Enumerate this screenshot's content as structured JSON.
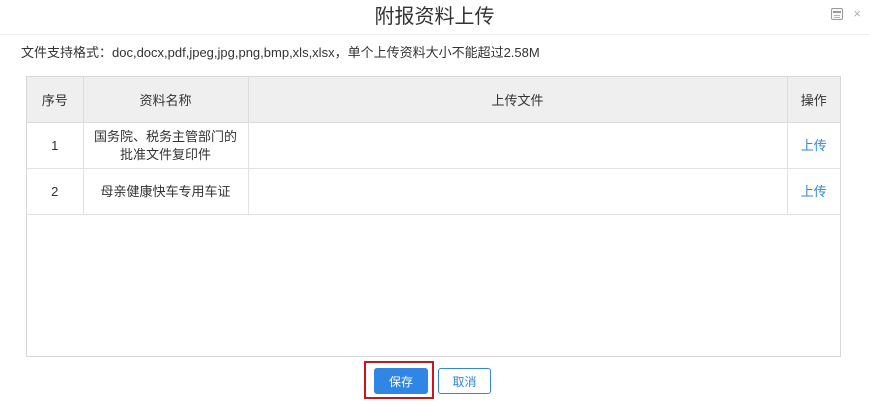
{
  "dialog": {
    "title": "附报资料上传",
    "formats_note": "文件支持格式：doc,docx,pdf,jpeg,jpg,png,bmp,xls,xlsx，单个上传资料大小不能超过2.58M"
  },
  "table": {
    "headers": [
      "序号",
      "资料名称",
      "上传文件",
      "操作"
    ],
    "rows": [
      {
        "index": "1",
        "name": "国务院、税务主管部门的\n批准文件复印件",
        "file": "",
        "action": "上传"
      },
      {
        "index": "2",
        "name": "母亲健康快车专用车证",
        "file": "",
        "action": "上传"
      }
    ]
  },
  "footer": {
    "save_label": "保存",
    "cancel_label": "取消"
  },
  "colors": {
    "accent": "#2f86e5",
    "highlight": "#c8161d",
    "header_bg": "#efefef"
  },
  "icons": {
    "maximize": "maximize-icon",
    "close": "close-icon"
  }
}
